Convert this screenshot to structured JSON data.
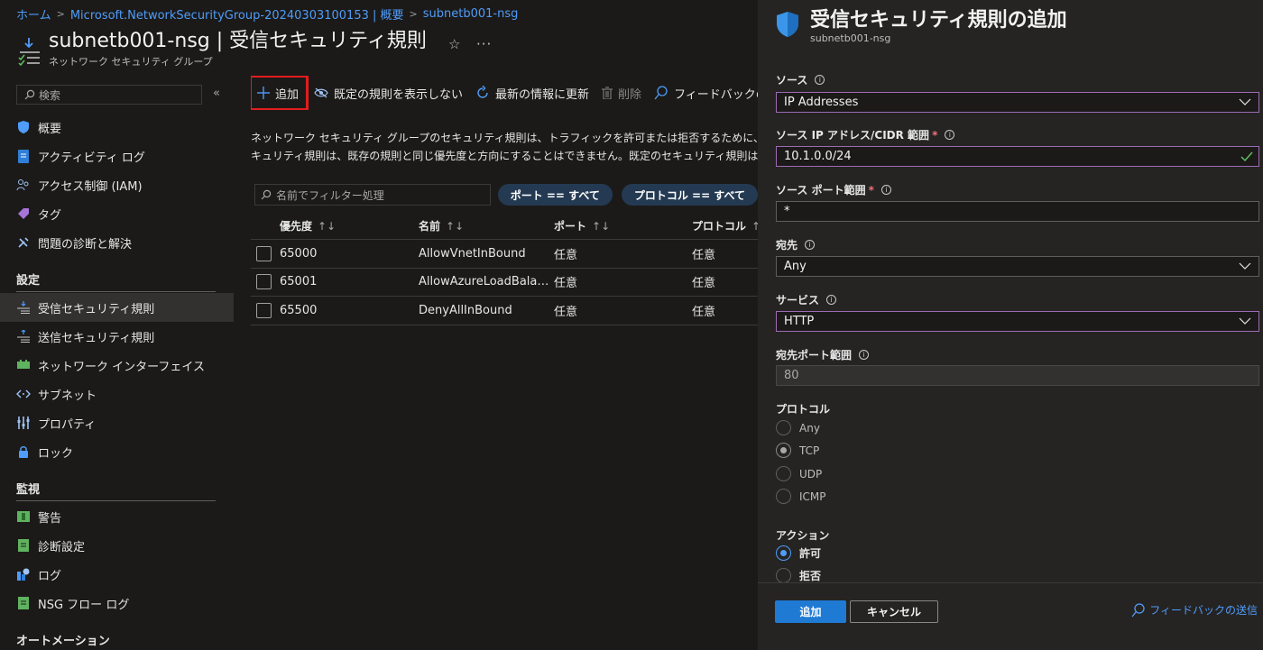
{
  "breadcrumb": [
    "ホーム",
    "Microsoft.NetworkSecurityGroup-20240303100153 | 概要",
    "subnetb001-nsg"
  ],
  "header": {
    "title": "subnetb001-nsg | 受信セキュリティ規則",
    "subtitle": "ネットワーク セキュリティ グループ",
    "star": "☆",
    "more": "···"
  },
  "sidebar": {
    "search_placeholder": "検索",
    "collapse": "«",
    "items": [
      {
        "label": "概要",
        "icon": "shield-icon"
      },
      {
        "label": "アクティビティ ログ",
        "icon": "activity-log-icon"
      },
      {
        "label": "アクセス制御 (IAM)",
        "icon": "people-icon"
      },
      {
        "label": "タグ",
        "icon": "tag-icon"
      },
      {
        "label": "問題の診断と解決",
        "icon": "wrench-icon"
      }
    ],
    "section_settings": "設定",
    "settings_items": [
      {
        "label": "受信セキュリティ規則",
        "icon": "inbound-rules-icon",
        "active": true
      },
      {
        "label": "送信セキュリティ規則",
        "icon": "outbound-rules-icon"
      },
      {
        "label": "ネットワーク インターフェイス",
        "icon": "nic-icon"
      },
      {
        "label": "サブネット",
        "icon": "subnet-icon"
      },
      {
        "label": "プロパティ",
        "icon": "properties-icon"
      },
      {
        "label": "ロック",
        "icon": "lock-icon"
      }
    ],
    "section_monitor": "監視",
    "monitor_items": [
      {
        "label": "警告",
        "icon": "alert-icon"
      },
      {
        "label": "診断設定",
        "icon": "diagnostics-icon"
      },
      {
        "label": "ログ",
        "icon": "logs-icon"
      },
      {
        "label": "NSG フロー ログ",
        "icon": "flow-log-icon"
      }
    ],
    "section_automation": "オートメーション"
  },
  "toolbar": {
    "add": "追加",
    "hide_default": "既定の規則を表示しない",
    "refresh": "最新の情報に更新",
    "delete": "削除",
    "feedback": "フィードバックの送信"
  },
  "description": {
    "line1": "ネットワーク セキュリティ グループのセキュリティ規則は、トラフィックを許可または拒否するために、ソース、宛先、ポート、およびプロトコルに基づいて評価されます。",
    "line2": "キュリティ規則は、既存の規則と同じ優先度と方向にすることはできません。既定のセキュリティ規則は削除できませんが、より高い優先度の規則でオーバーライドできます。"
  },
  "filters": {
    "placeholder": "名前でフィルター処理",
    "port_pill": "ポート == すべて",
    "protocol_pill": "プロトコル == すべて"
  },
  "table": {
    "columns": [
      "優先度",
      "名前",
      "ポート",
      "プロトコル"
    ],
    "rows": [
      {
        "priority": "65000",
        "name": "AllowVnetInBound",
        "port": "任意",
        "protocol": "任意"
      },
      {
        "priority": "65001",
        "name": "AllowAzureLoadBalancerInBound",
        "port": "任意",
        "protocol": "任意"
      },
      {
        "priority": "65500",
        "name": "DenyAllInBound",
        "port": "任意",
        "protocol": "任意"
      }
    ]
  },
  "panel": {
    "title": "受信セキュリティ規則の追加",
    "subtitle": "subnetb001-nsg",
    "source_label": "ソース",
    "source_value": "IP Addresses",
    "source_ip_label": "ソース IP アドレス/CIDR 範囲",
    "source_ip_value": "10.1.0.0/24",
    "source_port_label": "ソース ポート範囲",
    "source_port_value": "*",
    "dest_label": "宛先",
    "dest_value": "Any",
    "service_label": "サービス",
    "service_value": "HTTP",
    "dest_port_label": "宛先ポート範囲",
    "dest_port_value": "80",
    "protocol_label": "プロトコル",
    "protocol_options": [
      "Any",
      "TCP",
      "UDP",
      "ICMP"
    ],
    "protocol_selected": "TCP",
    "action_label": "アクション",
    "action_options": [
      "許可",
      "拒否"
    ],
    "action_selected": "許可",
    "required_mark": "*",
    "add_button": "追加",
    "cancel_button": "キャンセル",
    "feedback": "フィードバックの送信"
  },
  "colors": {
    "background": "#1b1a19",
    "panel": "#252423",
    "accent": "#1f7ad4",
    "link": "#4f9cf9",
    "highlight_border": "#e21d1d"
  }
}
